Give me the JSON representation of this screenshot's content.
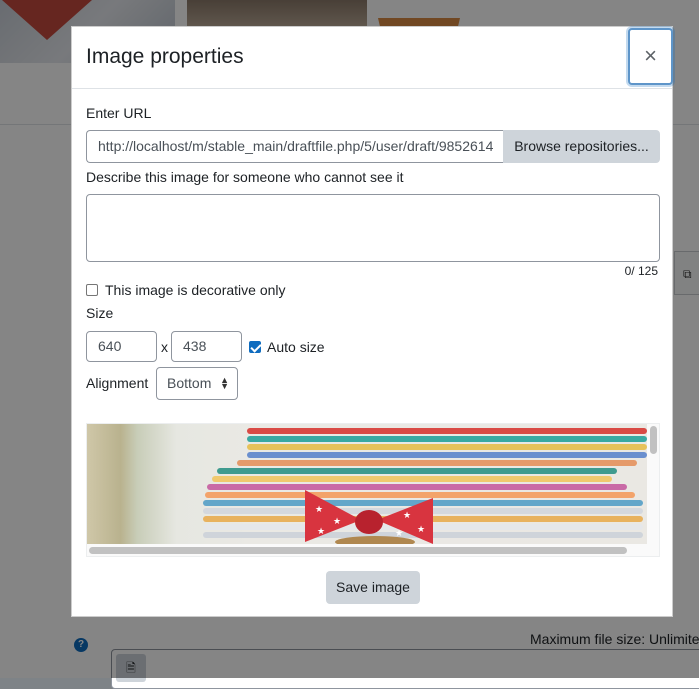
{
  "dialog": {
    "title": "Image properties",
    "close_icon": "×",
    "url_label": "Enter URL",
    "url_value": "http://localhost/m/stable_main/draftfile.php/5/user/draft/9852614",
    "browse_label": "Browse repositories...",
    "alt_label": "Describe this image for someone who cannot see it",
    "alt_value": "",
    "alt_counter": "0/ 125",
    "decorative_label": "This image is decorative only",
    "decorative_checked": false,
    "size_label": "Size",
    "width_value": "640",
    "times_sign": "x",
    "height_value": "438",
    "auto_size_label": "Auto size",
    "auto_size_checked": true,
    "alignment_label": "Alignment",
    "alignment_value": "Bottom",
    "save_label": "Save image"
  },
  "background": {
    "max_file_size": "Maximum file size: Unlimited",
    "help_icon": "?"
  },
  "colors": {
    "accent": "#0f6cbf",
    "button_secondary": "#ced4da",
    "backdrop": "rgba(0,0,0,0.48)"
  }
}
